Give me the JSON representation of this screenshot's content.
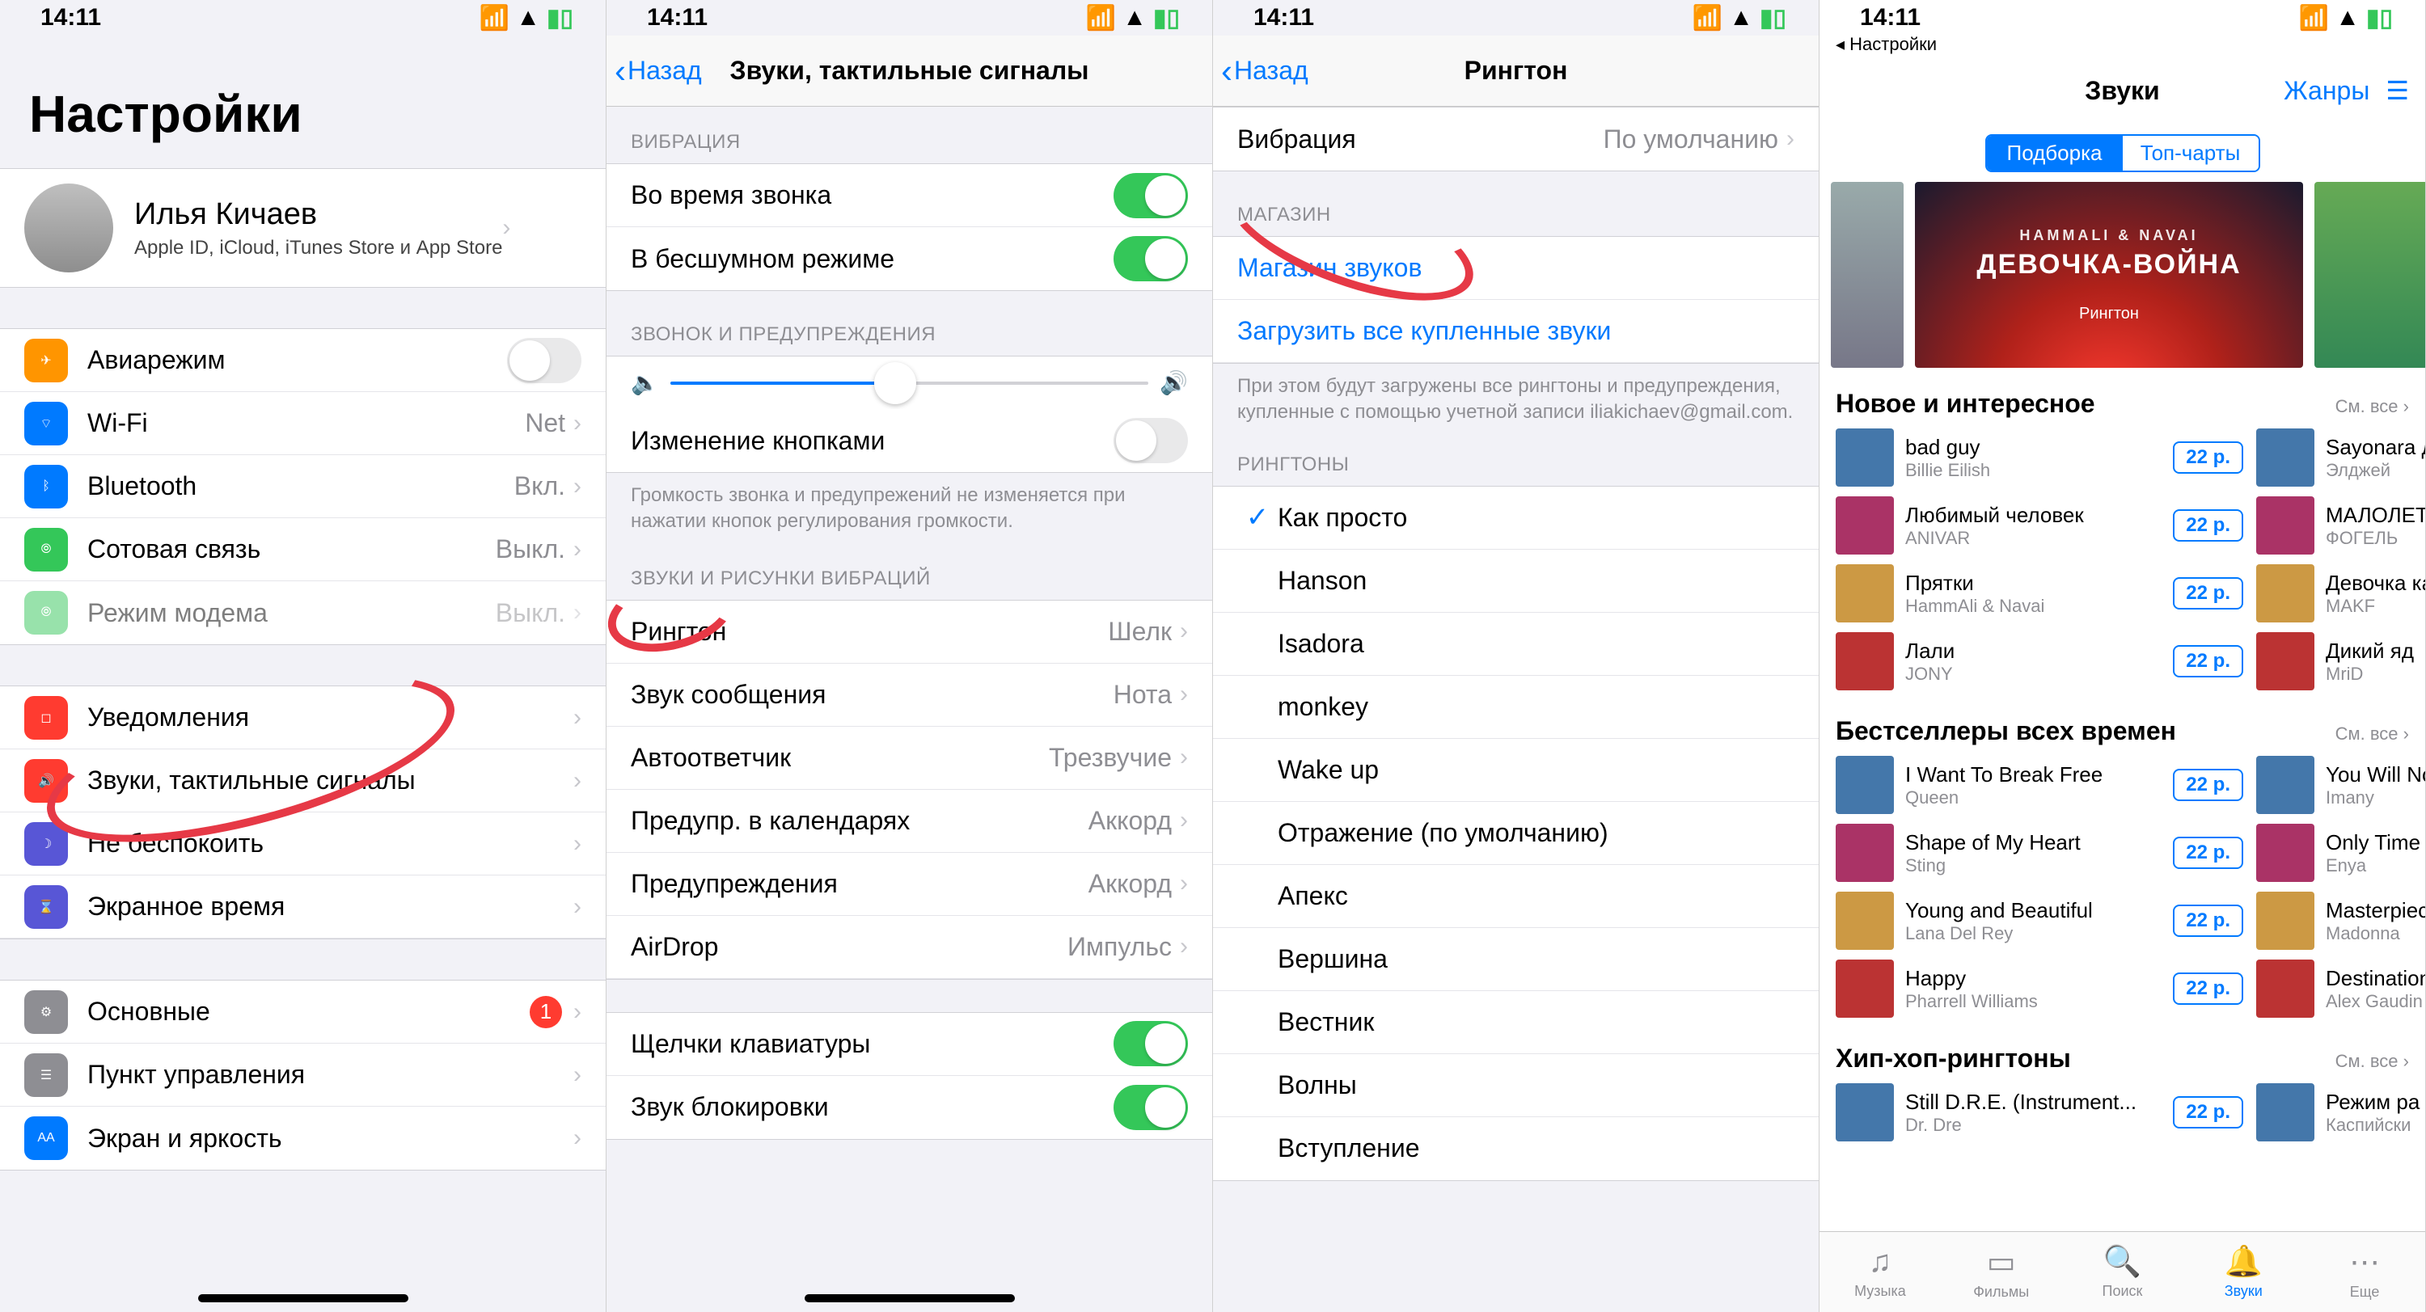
{
  "global": {
    "time": "14:11",
    "back_label": "Назад",
    "chevron": "›",
    "back_chevron": "‹"
  },
  "p1": {
    "title": "Настройки",
    "profile_name": "Илья Кичаев",
    "profile_sub": "Apple ID, iCloud, iTunes Store и App Store",
    "rows": {
      "airplane": "Авиарежим",
      "wifi": "Wi-Fi",
      "wifi_val": "Net",
      "bt": "Bluetooth",
      "bt_val": "Вкл.",
      "cell": "Сотовая связь",
      "cell_val": "Выкл.",
      "hotspot": "Режим модема",
      "hotspot_val": "Выкл.",
      "notif": "Уведомления",
      "sounds": "Звуки, тактильные сигналы",
      "dnd": "Не беспокоить",
      "screentime": "Экранное время",
      "general": "Основные",
      "general_badge": "1",
      "control": "Пункт управления",
      "display": "Экран и яркость"
    }
  },
  "p2": {
    "title": "Звуки, тактильные сигналы",
    "hdr_vibration": "ВИБРАЦИЯ",
    "vib_ring": "Во время звонка",
    "vib_silent": "В бесшумном режиме",
    "hdr_ringer": "ЗВОНОК И ПРЕДУПРЕЖДЕНИЯ",
    "change_buttons": "Изменение кнопками",
    "change_buttons_footer": "Громкость звонка и предупрежений не изменяется при нажатии кнопок регулирования громкости.",
    "hdr_sounds": "ЗВУКИ И РИСУНКИ ВИБРАЦИЙ",
    "ringtone": "Рингтон",
    "ringtone_val": "Шелк",
    "texttone": "Звук сообщения",
    "texttone_val": "Нота",
    "voicemail": "Автоответчик",
    "voicemail_val": "Трезвучие",
    "cal": "Предупр. в календарях",
    "cal_val": "Аккорд",
    "rem": "Предупреждения",
    "rem_val": "Аккорд",
    "airdrop": "AirDrop",
    "airdrop_val": "Импульс",
    "keyclick": "Щелчки клавиатуры",
    "lock": "Звук блокировки"
  },
  "p3": {
    "title": "Рингтон",
    "vibration": "Вибрация",
    "vibration_val": "По умолчанию",
    "hdr_store": "МАГАЗИН",
    "store_link": "Магазин звуков",
    "download_link": "Загрузить все купленные звуки",
    "download_footer": "При этом будут загружены все рингтоны и предупреждения, купленные с помощью учетной записи iliakichaev@gmail.com.",
    "hdr_ringtones": "РИНГТОНЫ",
    "tones": [
      "Как просто",
      "Hanson",
      "Isadora",
      "monkey",
      "Wake up",
      "Отражение (по умолчанию)",
      "Апекс",
      "Вершина",
      "Вестник",
      "Волны",
      "Вступление"
    ]
  },
  "p4": {
    "back_app": "◂ Настройки",
    "title": "Звуки",
    "genres": "Жанры",
    "seg_featured": "Подборка",
    "seg_charts": "Топ-чарты",
    "hero_artist": "HAMMALI & NAVAI",
    "hero_title": "ДЕВОЧКА-ВОЙНА",
    "hero_type": "Рингтон",
    "see_all_label": "См. все",
    "sec1": "Новое и интересное",
    "sec1_tracks": [
      {
        "t": "bad guy",
        "a": "Billie Eilish",
        "p": "22 р."
      },
      {
        "t": "Любимый человек",
        "a": "ANIVAR",
        "p": "22 р."
      },
      {
        "t": "Прятки",
        "a": "HammAli & Navai",
        "p": "22 р."
      },
      {
        "t": "Лали",
        "a": "JONY",
        "p": "22 р."
      }
    ],
    "sec1b_tracks": [
      {
        "t": "Sayonara дет",
        "a": "Элджей",
        "p": ""
      },
      {
        "t": "МАЛОЛЕТ",
        "a": "ФОГЕЛЬ",
        "p": ""
      },
      {
        "t": "Девочка ка",
        "a": "MAKF",
        "p": ""
      },
      {
        "t": "Дикий яд",
        "a": "MriD",
        "p": ""
      }
    ],
    "sec2": "Бестселлеры всех времен",
    "sec2_tracks": [
      {
        "t": "I Want To Break Free",
        "a": "Queen",
        "p": "22 р."
      },
      {
        "t": "Shape of My Heart",
        "a": "Sting",
        "p": "22 р."
      },
      {
        "t": "Young and Beautiful",
        "a": "Lana Del Rey",
        "p": "22 р."
      },
      {
        "t": "Happy",
        "a": "Pharrell Williams",
        "p": "22 р."
      }
    ],
    "sec2b_tracks": [
      {
        "t": "You Will No",
        "a": "Imany",
        "p": ""
      },
      {
        "t": "Only Time",
        "a": "Enya",
        "p": ""
      },
      {
        "t": "Masterpiec",
        "a": "Madonna",
        "p": ""
      },
      {
        "t": "Destination",
        "a": "Alex Gaudin",
        "p": ""
      }
    ],
    "sec3": "Хип-хоп-рингтоны",
    "sec3_tracks": [
      {
        "t": "Still D.R.E. (Instrument...",
        "a": "Dr. Dre",
        "p": "22 р."
      }
    ],
    "sec3b_tracks": [
      {
        "t": "Режим ра",
        "a": "Каспийски",
        "p": ""
      }
    ],
    "tabs": {
      "music": "Музыка",
      "movies": "Фильмы",
      "search": "Поиск",
      "sounds": "Звуки",
      "more": "Еще"
    }
  }
}
